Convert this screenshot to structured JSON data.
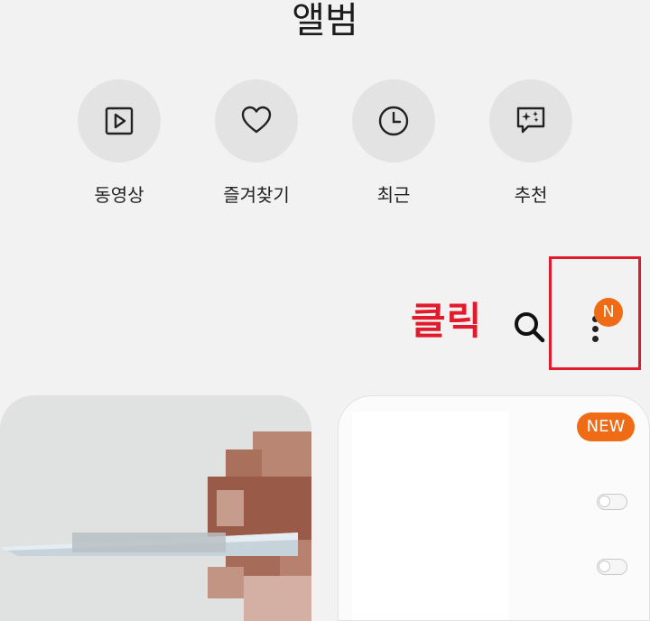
{
  "header": {
    "title": "앨범"
  },
  "quick_actions": [
    {
      "label": "동영상",
      "icon": "play-icon"
    },
    {
      "label": "즐겨찾기",
      "icon": "heart-icon"
    },
    {
      "label": "최근",
      "icon": "clock-icon"
    },
    {
      "label": "추천",
      "icon": "sparkle-chat-icon"
    }
  ],
  "toolbar": {
    "annotation_text": "클릭",
    "search_icon": "search-icon",
    "more_icon": "more-vertical-icon",
    "notification_badge": "N"
  },
  "cards": {
    "right": {
      "new_badge": "NEW"
    }
  },
  "colors": {
    "background": "#f2f2f2",
    "accent_orange": "#ef6b16",
    "annotation_red": "#e11b2b"
  }
}
